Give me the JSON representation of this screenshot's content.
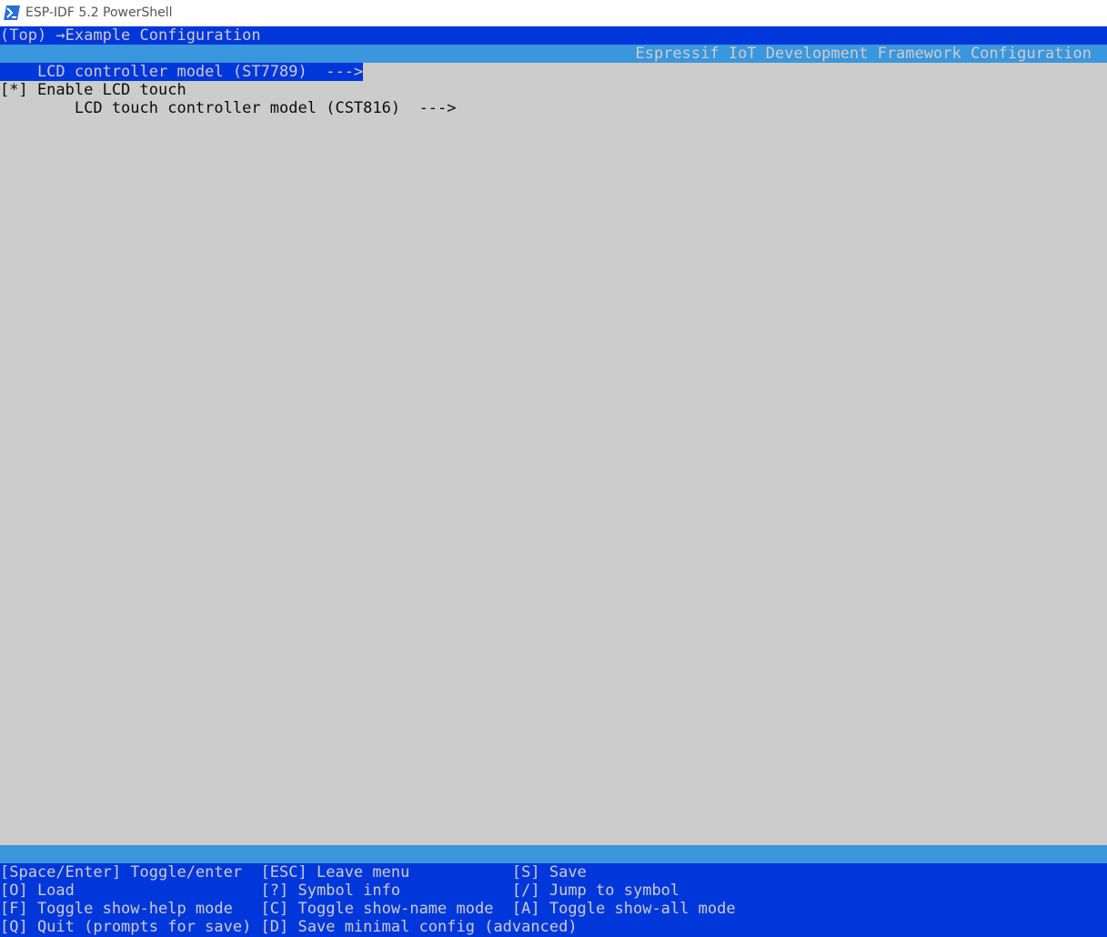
{
  "window": {
    "title": "ESP-IDF 5.2 PowerShell",
    "icon": "powershell-icon"
  },
  "header": {
    "breadcrumb": "(Top) →Example Configuration",
    "framework_title": "Espressif IoT Development Framework Configuration"
  },
  "menu": {
    "items": [
      {
        "text": "    LCD controller model (ST7789)  --->",
        "selected": true
      },
      {
        "text": "[*] Enable LCD touch",
        "selected": false
      },
      {
        "text": "        LCD touch controller model (CST816)  --->",
        "selected": false
      }
    ]
  },
  "footer": {
    "lines": [
      "[Space/Enter] Toggle/enter  [ESC] Leave menu           [S] Save",
      "[O] Load                    [?] Symbol info            [/] Jump to symbol",
      "[F] Toggle show-help mode   [C] Toggle show-name mode  [A] Toggle show-all mode",
      "[Q] Quit (prompts for save) [D] Save minimal config (advanced)"
    ]
  },
  "colors": {
    "terminal_bg": "#cccccc",
    "bar_dark_blue": "#0037da",
    "bar_light_blue": "#3a96dd",
    "text_gray": "#cccccc",
    "text_black": "#0c0c0c"
  }
}
